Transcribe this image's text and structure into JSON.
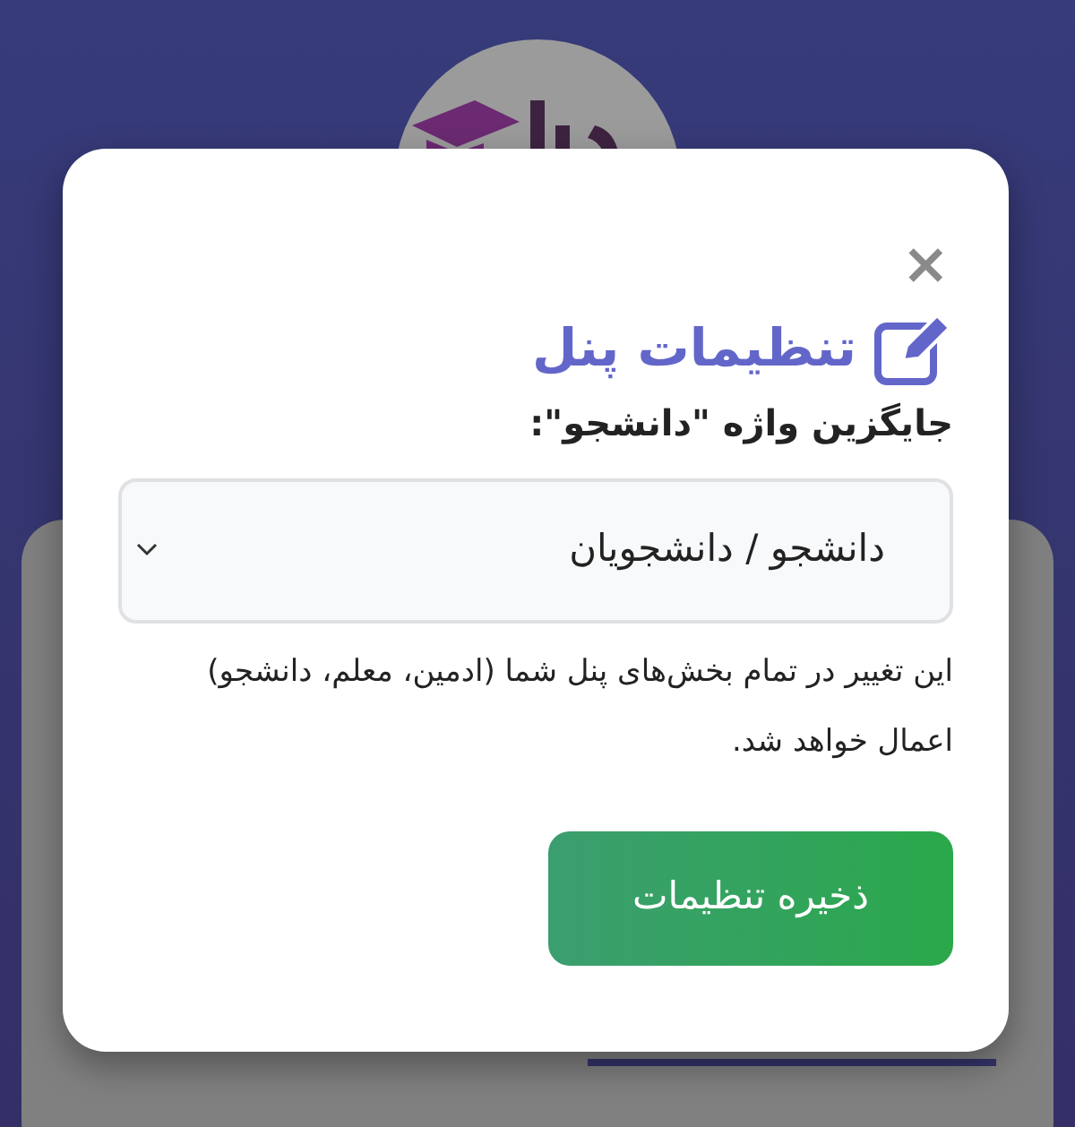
{
  "modal": {
    "close": "×",
    "title": "تنظیمات پنل",
    "field_label": "جایگزین واژه \"دانشجو\":",
    "select": {
      "value": "دانشجو / دانشجویان"
    },
    "help_text": "این تغییر در تمام بخش‌های پنل شما (ادمین، معلم، دانشجو) اعمال خواهد شد.",
    "save_button": "ذخیره تنظیمات"
  }
}
